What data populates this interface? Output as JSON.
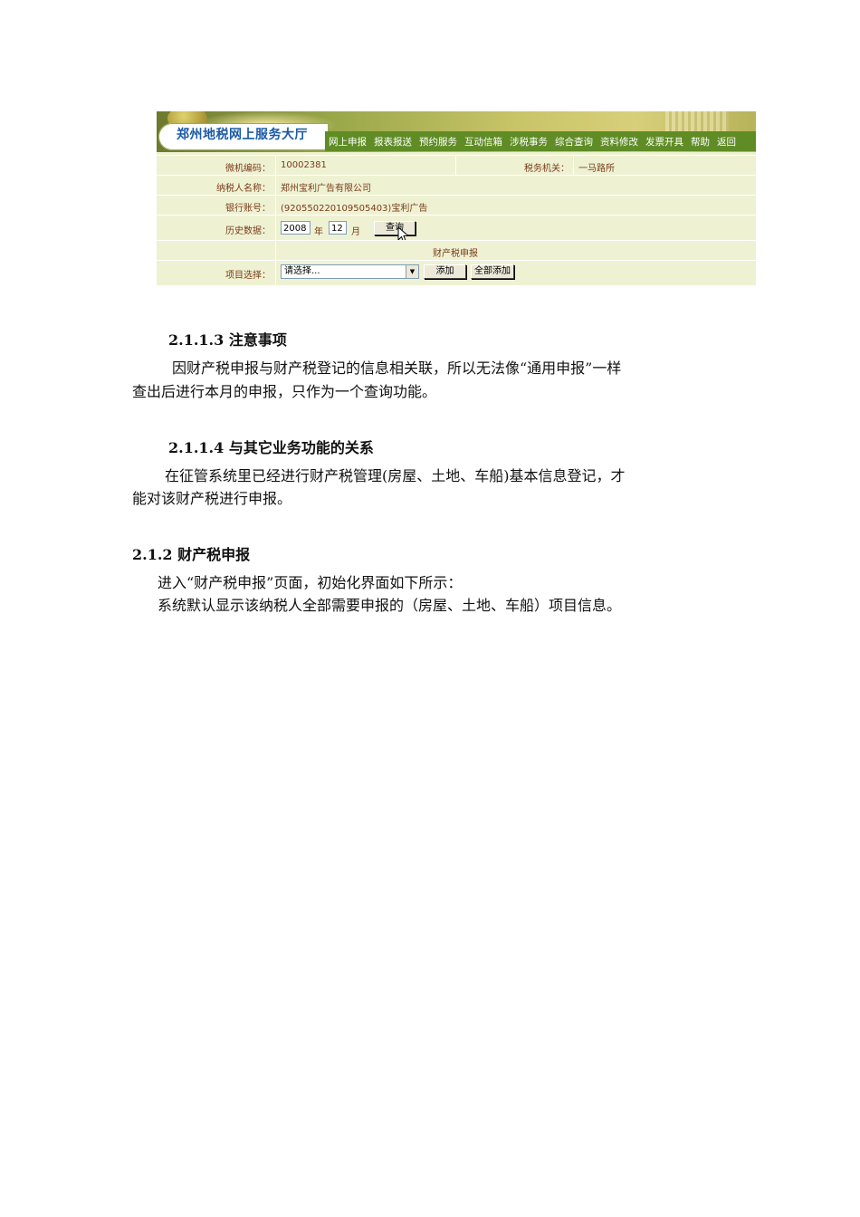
{
  "portal": {
    "title": "郑州地税网上服务大厅",
    "nav": [
      "网上申报",
      "报表报送",
      "预约服务",
      "互动信箱",
      "涉税事务",
      "综合查询",
      "资料修改",
      "发票开具",
      "帮助",
      "返回"
    ]
  },
  "form": {
    "machine_code_label": "微机编码：",
    "machine_code": "10002381",
    "tax_office_label": "税务机关：",
    "tax_office": "一马路所",
    "taxpayer_name_label": "纳税人名称：",
    "taxpayer_name": "郑州宝利广告有限公司",
    "bank_account_label": "银行账号：",
    "bank_account": "(920550220109505403)宝利广告",
    "history_label": "历史数据：",
    "year": "2008",
    "year_unit": "年",
    "month": "12",
    "month_unit": "月",
    "query_button": "查询",
    "section_title": "财产税申报",
    "item_select_label": "项目选择：",
    "item_select_value": "请选择...",
    "add_button": "添加",
    "add_all_button": "全部添加"
  },
  "doc": {
    "h1": "2.1.1.3 注意事项",
    "p1_line1": "因财产税申报与财产税登记的信息相关联，所以无法像“通用申报”一样",
    "p1_line2": "查出后进行本月的申报，只作为一个查询功能。",
    "h2": "2.1.1.4 与其它业务功能的关系",
    "p2_line1": "在征管系统里已经进行财产税管理(房屋、土地、车船)基本信息登记，才",
    "p2_line2": "能对该财产税进行申报。",
    "h3": "2.1.2 财产税申报",
    "p3_line1": "进入“财产税申报”页面，初始化界面如下所示：",
    "p3_line2": "系统默认显示该纳税人全部需要申报的（房屋、土地、车船）项目信息。"
  }
}
